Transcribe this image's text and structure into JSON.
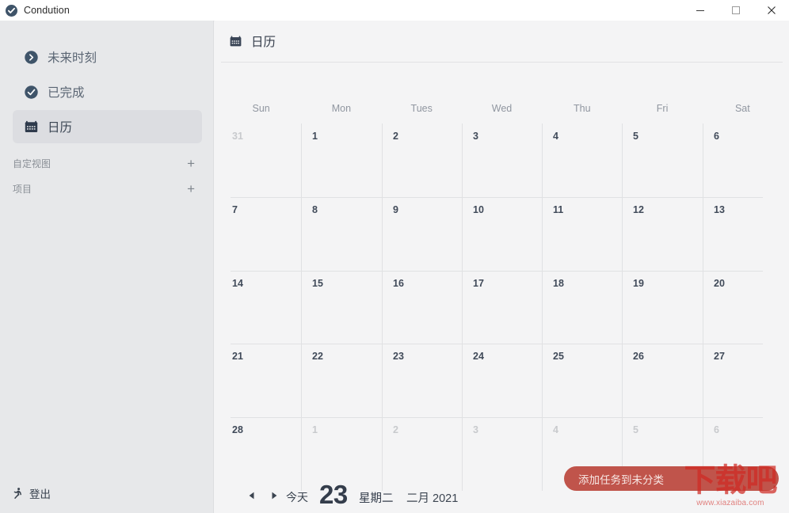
{
  "window": {
    "title": "Condution",
    "app_icon": "check-circle-icon",
    "controls": {
      "minimize": "minimize-icon",
      "maximize": "maximize-icon",
      "close": "close-icon"
    }
  },
  "sidebar": {
    "items": [
      {
        "label": "未来时刻",
        "icon": "chevron-circle-right-icon",
        "selected": false
      },
      {
        "label": "已完成",
        "icon": "check-circle-icon",
        "selected": false
      },
      {
        "label": "日历",
        "icon": "calendar-icon",
        "selected": true
      }
    ],
    "sections": [
      {
        "label": "自定视图",
        "add": "+"
      },
      {
        "label": "项目",
        "add": "+"
      }
    ],
    "logout": {
      "label": "登出",
      "icon": "run-exit-icon"
    }
  },
  "main": {
    "header": {
      "title": "日历",
      "icon": "calendar-icon"
    },
    "weekdays": [
      "Sun",
      "Mon",
      "Tues",
      "Wed",
      "Thu",
      "Fri",
      "Sat"
    ],
    "weeks": [
      [
        {
          "n": "31",
          "out": true
        },
        {
          "n": "1",
          "out": false
        },
        {
          "n": "2",
          "out": false
        },
        {
          "n": "3",
          "out": false
        },
        {
          "n": "4",
          "out": false
        },
        {
          "n": "5",
          "out": false
        },
        {
          "n": "6",
          "out": false
        }
      ],
      [
        {
          "n": "7",
          "out": false
        },
        {
          "n": "8",
          "out": false
        },
        {
          "n": "9",
          "out": false
        },
        {
          "n": "10",
          "out": false
        },
        {
          "n": "11",
          "out": false
        },
        {
          "n": "12",
          "out": false
        },
        {
          "n": "13",
          "out": false
        }
      ],
      [
        {
          "n": "14",
          "out": false
        },
        {
          "n": "15",
          "out": false
        },
        {
          "n": "16",
          "out": false
        },
        {
          "n": "17",
          "out": false
        },
        {
          "n": "18",
          "out": false
        },
        {
          "n": "19",
          "out": false
        },
        {
          "n": "20",
          "out": false
        }
      ],
      [
        {
          "n": "21",
          "out": false
        },
        {
          "n": "22",
          "out": false
        },
        {
          "n": "23",
          "out": false
        },
        {
          "n": "24",
          "out": false
        },
        {
          "n": "25",
          "out": false
        },
        {
          "n": "26",
          "out": false
        },
        {
          "n": "27",
          "out": false
        }
      ],
      [
        {
          "n": "28",
          "out": false
        },
        {
          "n": "1",
          "out": true
        },
        {
          "n": "2",
          "out": true
        },
        {
          "n": "3",
          "out": true
        },
        {
          "n": "4",
          "out": true
        },
        {
          "n": "5",
          "out": true
        },
        {
          "n": "6",
          "out": true
        }
      ]
    ]
  },
  "bottombar": {
    "prev_icon": "triangle-left-icon",
    "next_icon": "triangle-right-icon",
    "today_label": "今天",
    "day_number": "23",
    "weekday_label": "星期二",
    "month_year_label": "二月 2021",
    "add_task_label": "添加任务到未分类"
  },
  "watermark": {
    "text": "下载吧",
    "url": "www.xiazaiba.com"
  },
  "colors": {
    "accent_red": "#c0544b",
    "sidebar_bg": "#e7e8ea",
    "main_bg": "#f4f4f5",
    "icon_dark": "#3f5469"
  }
}
